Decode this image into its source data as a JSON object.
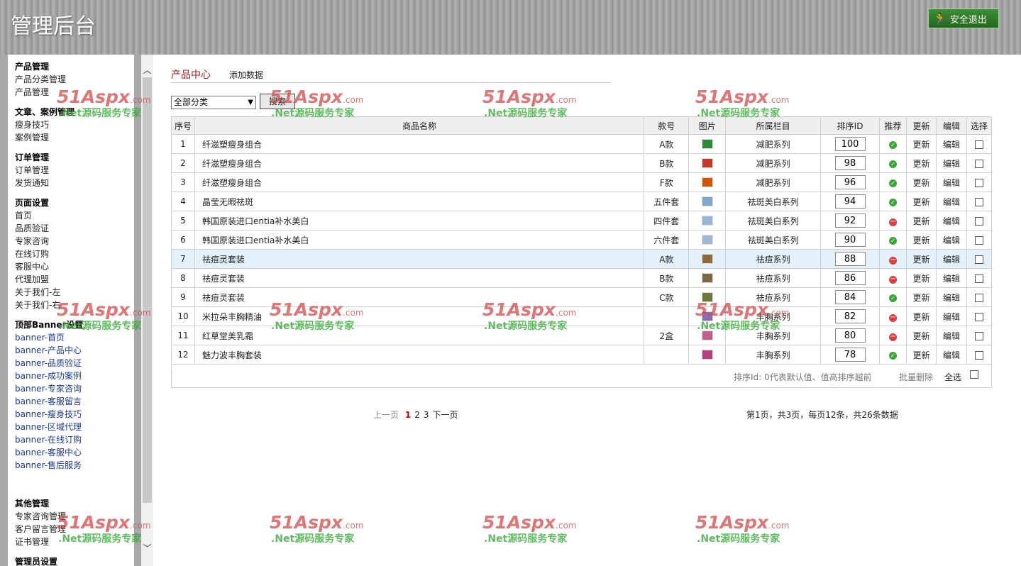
{
  "header": {
    "title": "管理后台",
    "logout_label": "安全退出"
  },
  "sidebar": {
    "groups": [
      {
        "title": "产品管理",
        "items": [
          "产品分类管理",
          "产品管理"
        ]
      },
      {
        "title": "文章、案例管理",
        "items": [
          "瘦身技巧",
          "案例管理"
        ]
      },
      {
        "title": "订单管理",
        "items": [
          "订单管理",
          "发货通知"
        ]
      },
      {
        "title": "页面设置",
        "items": [
          "首页",
          "品质验证",
          "专家咨询",
          "在线订购",
          "客服中心",
          "代理加盟",
          "关于我们-左",
          "关于我们-右"
        ]
      },
      {
        "title": "顶部Banner设置",
        "items": [
          "banner-首页",
          "banner-产品中心",
          "banner-品质验证",
          "banner-成功案例",
          "banner-专家咨询",
          "banner-客服留言",
          "banner-瘦身技巧",
          "banner-区域代理",
          "banner-在线订购",
          "banner-客服中心",
          "banner-售后服务"
        ]
      },
      {
        "title": "其他管理",
        "items": [
          "专家咨询管理",
          "客户留言管理",
          "证书管理"
        ]
      },
      {
        "title": "管理员设置",
        "items": []
      }
    ]
  },
  "main": {
    "tabs": {
      "active": "产品中心",
      "add": "添加数据"
    },
    "filter": {
      "selected": "全部分类",
      "search_label": "搜索"
    },
    "table": {
      "headers": [
        "序号",
        "商品名称",
        "款号",
        "图片",
        "所属栏目",
        "排序ID",
        "推荐",
        "更新",
        "编辑",
        "选择"
      ],
      "rows": [
        {
          "no": "1",
          "name": "纤滋塑瘦身组合",
          "model": "A款",
          "category": "减肥系列",
          "sort": "100",
          "rec": true,
          "update": "更新",
          "edit": "编辑"
        },
        {
          "no": "2",
          "name": "纤滋塑瘦身组合",
          "model": "B款",
          "category": "减肥系列",
          "sort": "98",
          "rec": true,
          "update": "更新",
          "edit": "编辑"
        },
        {
          "no": "3",
          "name": "纤滋塑瘦身组合",
          "model": "F款",
          "category": "减肥系列",
          "sort": "96",
          "rec": true,
          "update": "更新",
          "edit": "编辑"
        },
        {
          "no": "4",
          "name": "晶莹无暇祛斑",
          "model": "五件套",
          "category": "祛斑美白系列",
          "sort": "94",
          "rec": true,
          "update": "更新",
          "edit": "编辑"
        },
        {
          "no": "5",
          "name": "韩国原装进口entia补水美白",
          "model": "四件套",
          "category": "祛斑美白系列",
          "sort": "92",
          "rec": false,
          "update": "更新",
          "edit": "编辑"
        },
        {
          "no": "6",
          "name": "韩国原装进口entia补水美白",
          "model": "六件套",
          "category": "祛斑美白系列",
          "sort": "90",
          "rec": true,
          "update": "更新",
          "edit": "编辑"
        },
        {
          "no": "7",
          "name": "祛痘灵套装",
          "model": "A款",
          "category": "祛痘系列",
          "sort": "88",
          "rec": false,
          "update": "更新",
          "edit": "编辑"
        },
        {
          "no": "8",
          "name": "祛痘灵套装",
          "model": "B款",
          "category": "祛痘系列",
          "sort": "86",
          "rec": false,
          "update": "更新",
          "edit": "编辑"
        },
        {
          "no": "9",
          "name": "祛痘灵套装",
          "model": "C款",
          "category": "祛痘系列",
          "sort": "84",
          "rec": true,
          "update": "更新",
          "edit": "编辑"
        },
        {
          "no": "10",
          "name": "米拉朵丰胸精油",
          "model": "",
          "category": "丰胸系列",
          "sort": "82",
          "rec": false,
          "update": "更新",
          "edit": "编辑"
        },
        {
          "no": "11",
          "name": "红草堂美乳霜",
          "model": "2盒",
          "category": "丰胸系列",
          "sort": "80",
          "rec": false,
          "update": "更新",
          "edit": "编辑"
        },
        {
          "no": "12",
          "name": "魅力波丰胸套装",
          "model": "",
          "category": "丰胸系列",
          "sort": "78",
          "rec": true,
          "update": "更新",
          "edit": "编辑"
        }
      ],
      "thumb_colors": [
        "#2e8a3a",
        "#c0392b",
        "#d35400",
        "#7fa7c9",
        "#9ab6d8",
        "#a0b8d0",
        "#8b6b3a",
        "#7a6a4a",
        "#6b7a3a",
        "#8a6ab0",
        "#c06090",
        "#b04080"
      ]
    },
    "footer": {
      "hint": "排序Id: 0代表默认值、值高排序越前",
      "batch_delete": "批量删除",
      "select_all": "全选"
    },
    "pager": {
      "prev": "上一页",
      "pages": [
        "1",
        "2",
        "3"
      ],
      "current": "1",
      "next": "下一页",
      "info": "第1页，共3页，每页12条，共26条数据"
    }
  },
  "watermark": {
    "logo": "51Aspx",
    "domain": ".com",
    "sub": ".Net源码服务专家"
  },
  "colors": {
    "tab_active": "#a32020",
    "recommend_on": "#3aa635",
    "recommend_off": "#d84040",
    "logout_bg": "#2f7d28"
  }
}
